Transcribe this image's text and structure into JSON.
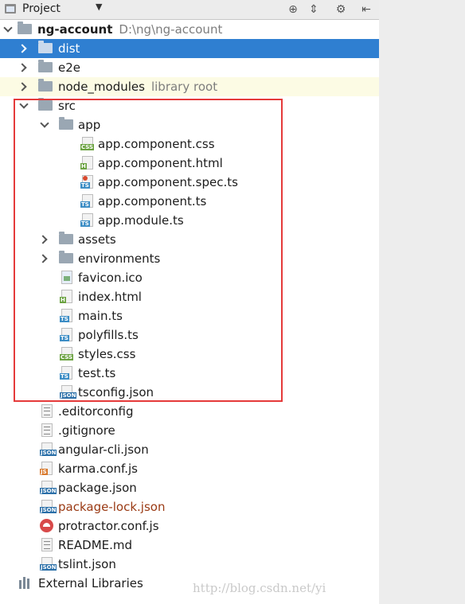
{
  "toolbar": {
    "title": "Project",
    "dropdown_icon": "chevron-down-icon",
    "buttons": [
      "target-icon",
      "collapse-all-icon",
      "gear-icon",
      "hide-panel-icon"
    ]
  },
  "tree": {
    "root": {
      "label": "ng-account",
      "path": "D:\\ng\\ng-account"
    },
    "items": [
      {
        "label": "dist"
      },
      {
        "label": "e2e"
      },
      {
        "label": "node_modules",
        "note": "library root"
      },
      {
        "label": "src"
      },
      {
        "label": "app"
      },
      {
        "label": "app.component.css"
      },
      {
        "label": "app.component.html"
      },
      {
        "label": "app.component.spec.ts"
      },
      {
        "label": "app.component.ts"
      },
      {
        "label": "app.module.ts"
      },
      {
        "label": "assets"
      },
      {
        "label": "environments"
      },
      {
        "label": "favicon.ico"
      },
      {
        "label": "index.html"
      },
      {
        "label": "main.ts"
      },
      {
        "label": "polyfills.ts"
      },
      {
        "label": "styles.css"
      },
      {
        "label": "test.ts"
      },
      {
        "label": "tsconfig.json"
      },
      {
        "label": ".editorconfig"
      },
      {
        "label": ".gitignore"
      },
      {
        "label": "angular-cli.json"
      },
      {
        "label": "karma.conf.js"
      },
      {
        "label": "package.json"
      },
      {
        "label": "package-lock.json"
      },
      {
        "label": "protractor.conf.js"
      },
      {
        "label": "README.md"
      },
      {
        "label": "tslint.json"
      },
      {
        "label": "External Libraries"
      }
    ]
  },
  "file_tags": {
    "css": "CSS",
    "html": "H",
    "ts": "TS",
    "json": "JSON",
    "js": "JS"
  },
  "watermark": "http://blog.csdn.net/yi",
  "colors": {
    "selection": "#2f7fd1",
    "library_row": "#fcfbe4",
    "annotation_box": "#e53a3a",
    "vcs_modified": "#9a3a14"
  }
}
